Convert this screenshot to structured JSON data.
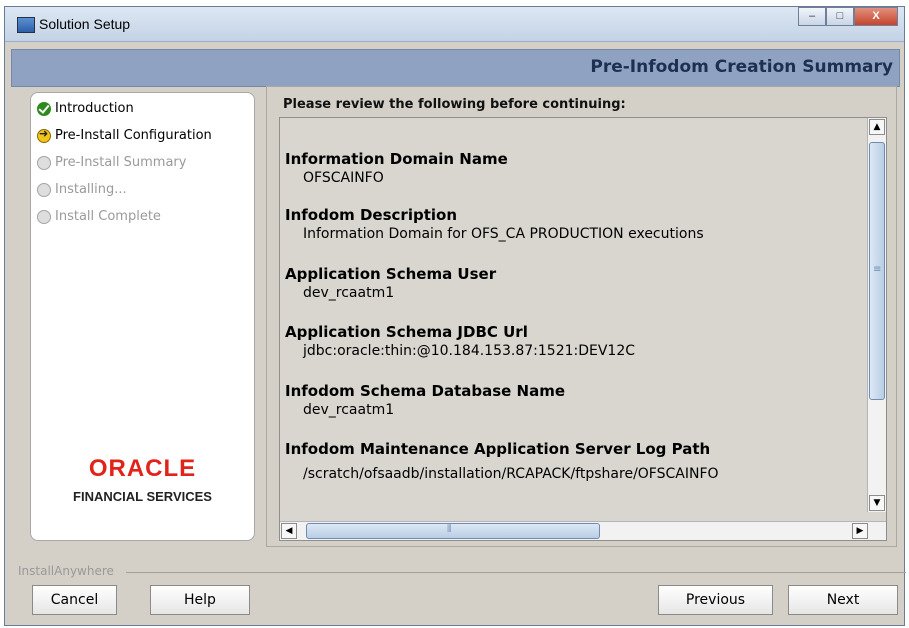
{
  "window": {
    "title": "Solution Setup",
    "controls": {
      "minimize": "–",
      "maximize": "□",
      "close": "X"
    }
  },
  "header": {
    "title": "Pre-Infodom Creation Summary"
  },
  "steps": [
    {
      "label": "Introduction",
      "status": "done",
      "icon": "check-circle-icon"
    },
    {
      "label": "Pre-Install Configuration",
      "status": "current",
      "icon": "arrow-circle-icon"
    },
    {
      "label": "Pre-Install Summary",
      "status": "pending",
      "icon": "empty-circle-icon"
    },
    {
      "label": "Installing...",
      "status": "pending",
      "icon": "empty-circle-icon"
    },
    {
      "label": "Install Complete",
      "status": "pending",
      "icon": "empty-circle-icon"
    }
  ],
  "branding": {
    "logo": "ORACLE",
    "subtitle": "FINANCIAL SERVICES"
  },
  "content": {
    "intro": "Please review the following before continuing:",
    "fields": [
      {
        "label": "Information Domain Name",
        "value": "OFSCAINFO"
      },
      {
        "label": "Infodom Description",
        "value": "Information Domain for OFS_CA PRODUCTION executions"
      },
      {
        "label": "Application Schema User",
        "value": "dev_rcaatm1"
      },
      {
        "label": "Application Schema JDBC Url",
        "value": "jdbc:oracle:thin:@10.184.153.87:1521:DEV12C"
      },
      {
        "label": "Infodom Schema Database Name",
        "value": "dev_rcaatm1"
      },
      {
        "label": "Infodom Maintenance Application Server Log Path",
        "value": "/scratch/ofsaadb/installation/RCAPACK/ftpshare/OFSCAINFO"
      }
    ]
  },
  "footer": {
    "label": "InstallAnywhere",
    "buttons": {
      "cancel": "Cancel",
      "help": "Help",
      "previous": "Previous",
      "next": "Next"
    }
  },
  "colors": {
    "header_bg": "#8fa2c1",
    "header_text": "#1e2f52",
    "oracle_red": "#e2231a",
    "step_done": "#2f8a1e",
    "step_current": "#f0c419"
  }
}
